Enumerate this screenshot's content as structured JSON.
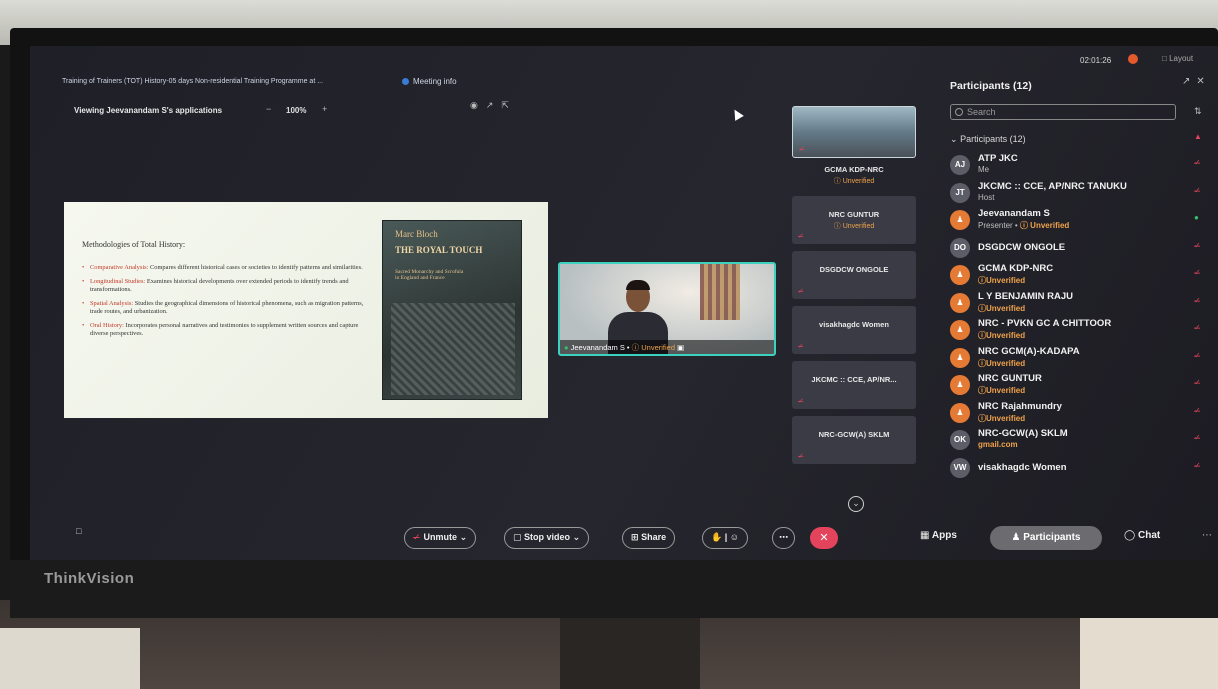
{
  "monitor": {
    "brand": "ThinkVision"
  },
  "meeting": {
    "title": "Training of Trainers (TOT) History-05 days Non-residential Training Programme at ...",
    "info_label": "Meeting info",
    "timer": "02:01:26",
    "layout_label": "Layout"
  },
  "share_bar": {
    "viewing": "Viewing Jeevanandam S's applications",
    "zoom_minus": "−",
    "zoom": "100%",
    "zoom_plus": "+"
  },
  "slide": {
    "heading": "Methodologies of Total History:",
    "items": [
      {
        "term": "Comparative Analysis:",
        "text": " Compares different historical cases or societies to identify patterns and similarities."
      },
      {
        "term": "Longitudinal Studies:",
        "text": " Examines historical developments over extended periods to identify trends and transformations."
      },
      {
        "term": "Spatial Analysis:",
        "text": " Studies the geographical dimensions of historical phenomena, such as migration patterns, trade routes, and urbanization."
      },
      {
        "term": "Oral History:",
        "text": " Incorporates personal narratives and testimonies to supplement written sources and capture diverse perspectives."
      }
    ],
    "book": {
      "author": "Marc Bloch",
      "title": "THE ROYAL TOUCH",
      "subtitle": "Sacred Monarchy and Scrofula in England and France"
    }
  },
  "main_video": {
    "name": "Jeevanandam S",
    "status": "Unverified"
  },
  "thumbnails": {
    "top_name": "GCMA KDP-NRC",
    "top_status": "Unverified",
    "items": [
      {
        "name": "NRC GUNTUR",
        "status": "Unverified"
      },
      {
        "name": "DSGDCW ONGOLE",
        "status": ""
      },
      {
        "name": "visakhagdc Women",
        "status": ""
      },
      {
        "name": "JKCMC :: CCE, AP/NR...",
        "status": ""
      },
      {
        "name": "NRC-GCW(A) SKLM",
        "status": ""
      }
    ]
  },
  "controls": {
    "unmute": "Unmute",
    "stop_video": "Stop video",
    "share": "Share",
    "apps": "Apps",
    "participants": "Participants",
    "chat": "Chat"
  },
  "panel": {
    "title": "Participants (12)",
    "search_placeholder": "Search",
    "section": "Participants (12)",
    "participants": [
      {
        "initials": "AJ",
        "name": "ATP JKC",
        "sub": "Me",
        "avatar": "grey",
        "mic": "off"
      },
      {
        "initials": "JT",
        "name": "JKCMC :: CCE, AP/NRC TANUKU",
        "sub": "Host",
        "avatar": "grey",
        "mic": "off"
      },
      {
        "initials": "",
        "name": "Jeevanandam S",
        "sub": "Presenter • ",
        "sub_unverified": "Unverified",
        "avatar": "orange",
        "mic": "on"
      },
      {
        "initials": "DO",
        "name": "DSGDCW ONGOLE",
        "sub": "",
        "avatar": "grey",
        "mic": "off"
      },
      {
        "initials": "",
        "name": "GCMA KDP-NRC",
        "sub_unverified": "Unverified",
        "avatar": "orange",
        "mic": "off"
      },
      {
        "initials": "",
        "name": "L Y BENJAMIN RAJU",
        "sub_unverified": "Unverified",
        "avatar": "orange",
        "mic": "off"
      },
      {
        "initials": "",
        "name": "NRC - PVKN GC A CHITTOOR",
        "sub_unverified": "Unverified",
        "avatar": "orange",
        "mic": "off"
      },
      {
        "initials": "",
        "name": "NRC GCM(A)-KADAPA",
        "sub_unverified": "Unverified",
        "avatar": "orange",
        "mic": "off"
      },
      {
        "initials": "",
        "name": "NRC GUNTUR",
        "sub_unverified": "Unverified",
        "avatar": "orange",
        "mic": "off"
      },
      {
        "initials": "",
        "name": "NRC Rajahmundry",
        "sub_unverified": "Unverified",
        "avatar": "orange",
        "mic": "off"
      },
      {
        "initials": "OK",
        "name": "NRC-GCW(A) SKLM",
        "sub_email": "gmail.com",
        "avatar": "grey",
        "mic": "off"
      },
      {
        "initials": "VW",
        "name": "visakhagdc Women",
        "sub": "",
        "avatar": "grey",
        "mic": "off"
      }
    ]
  },
  "colors": {
    "accent_teal": "#3dd2c0",
    "unverified": "#f0a24a",
    "mute_red": "#e4445b",
    "unmuted_green": "#36c06c"
  }
}
